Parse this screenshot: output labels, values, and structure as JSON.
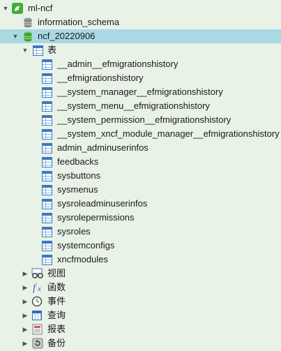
{
  "tree": {
    "connection": {
      "label": "ml-ncf",
      "icon": "mysql-dolphin-icon"
    },
    "databases": [
      {
        "label": "information_schema",
        "icon": "database-gray-icon"
      },
      {
        "label": "ncf_20220906",
        "icon": "database-green-icon",
        "selected": true
      }
    ],
    "tables_folder": {
      "label": "表",
      "icon": "table-icon"
    },
    "tables": [
      "__admin__efmigrationshistory",
      "__efmigrationshistory",
      "__system_manager__efmigrationshistory",
      "__system_menu__efmigrationshistory",
      "__system_permission__efmigrationshistory",
      "__system_xncf_module_manager__efmigrationshistory",
      "admin_adminuserinfos",
      "feedbacks",
      "sysbuttons",
      "sysmenus",
      "sysroleadminuserinfos",
      "sysrolepermissions",
      "sysroles",
      "systemconfigs",
      "xncfmodules"
    ],
    "other_folders": [
      {
        "label": "视图",
        "icon": "view-glasses-icon"
      },
      {
        "label": "函数",
        "icon": "function-fx-icon"
      },
      {
        "label": "事件",
        "icon": "event-clock-icon"
      },
      {
        "label": "查询",
        "icon": "query-grid-icon"
      },
      {
        "label": "报表",
        "icon": "report-icon"
      },
      {
        "label": "备份",
        "icon": "backup-icon"
      }
    ]
  },
  "colors": {
    "background": "#e9f2e7",
    "selected_row": "#a9d9e2",
    "table_icon_blue": "#3a78c4",
    "connection_green": "#3fae3a"
  }
}
